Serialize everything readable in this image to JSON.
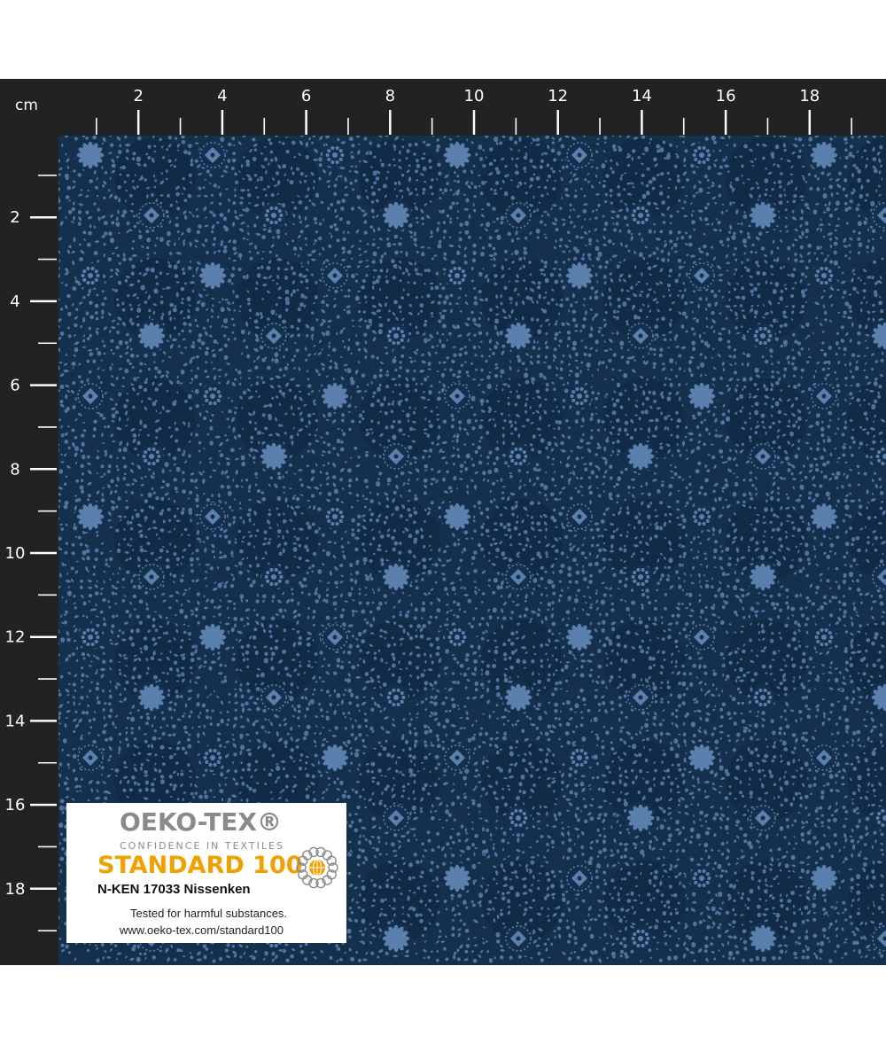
{
  "ruler": {
    "unit_label": "cm",
    "top_labels": [
      "2",
      "4",
      "6",
      "8",
      "10",
      "12",
      "14",
      "16",
      "18"
    ],
    "left_labels": [
      "2",
      "4",
      "6",
      "8",
      "10",
      "12",
      "14",
      "16",
      "18"
    ],
    "background_color": "#222222",
    "mark_color": "#ffffff"
  },
  "fabric": {
    "base_color": "#14304d",
    "motif_color": "#5b80ad",
    "dark_center_color": "#0f2640"
  },
  "certification_label": {
    "brand": "OEKO-TEX®",
    "tagline": "CONFIDENCE IN TEXTILES",
    "standard": "STANDARD 100",
    "certificate": "N-KEN 17033 Nissenken",
    "tested_text": "Tested for harmful substances.",
    "url": "www.oeko-tex.com/standard100",
    "logo_icon": "oeko-tex-flower-globe-icon",
    "brand_color": "#8a8a8a",
    "standard_color": "#f0a000"
  }
}
